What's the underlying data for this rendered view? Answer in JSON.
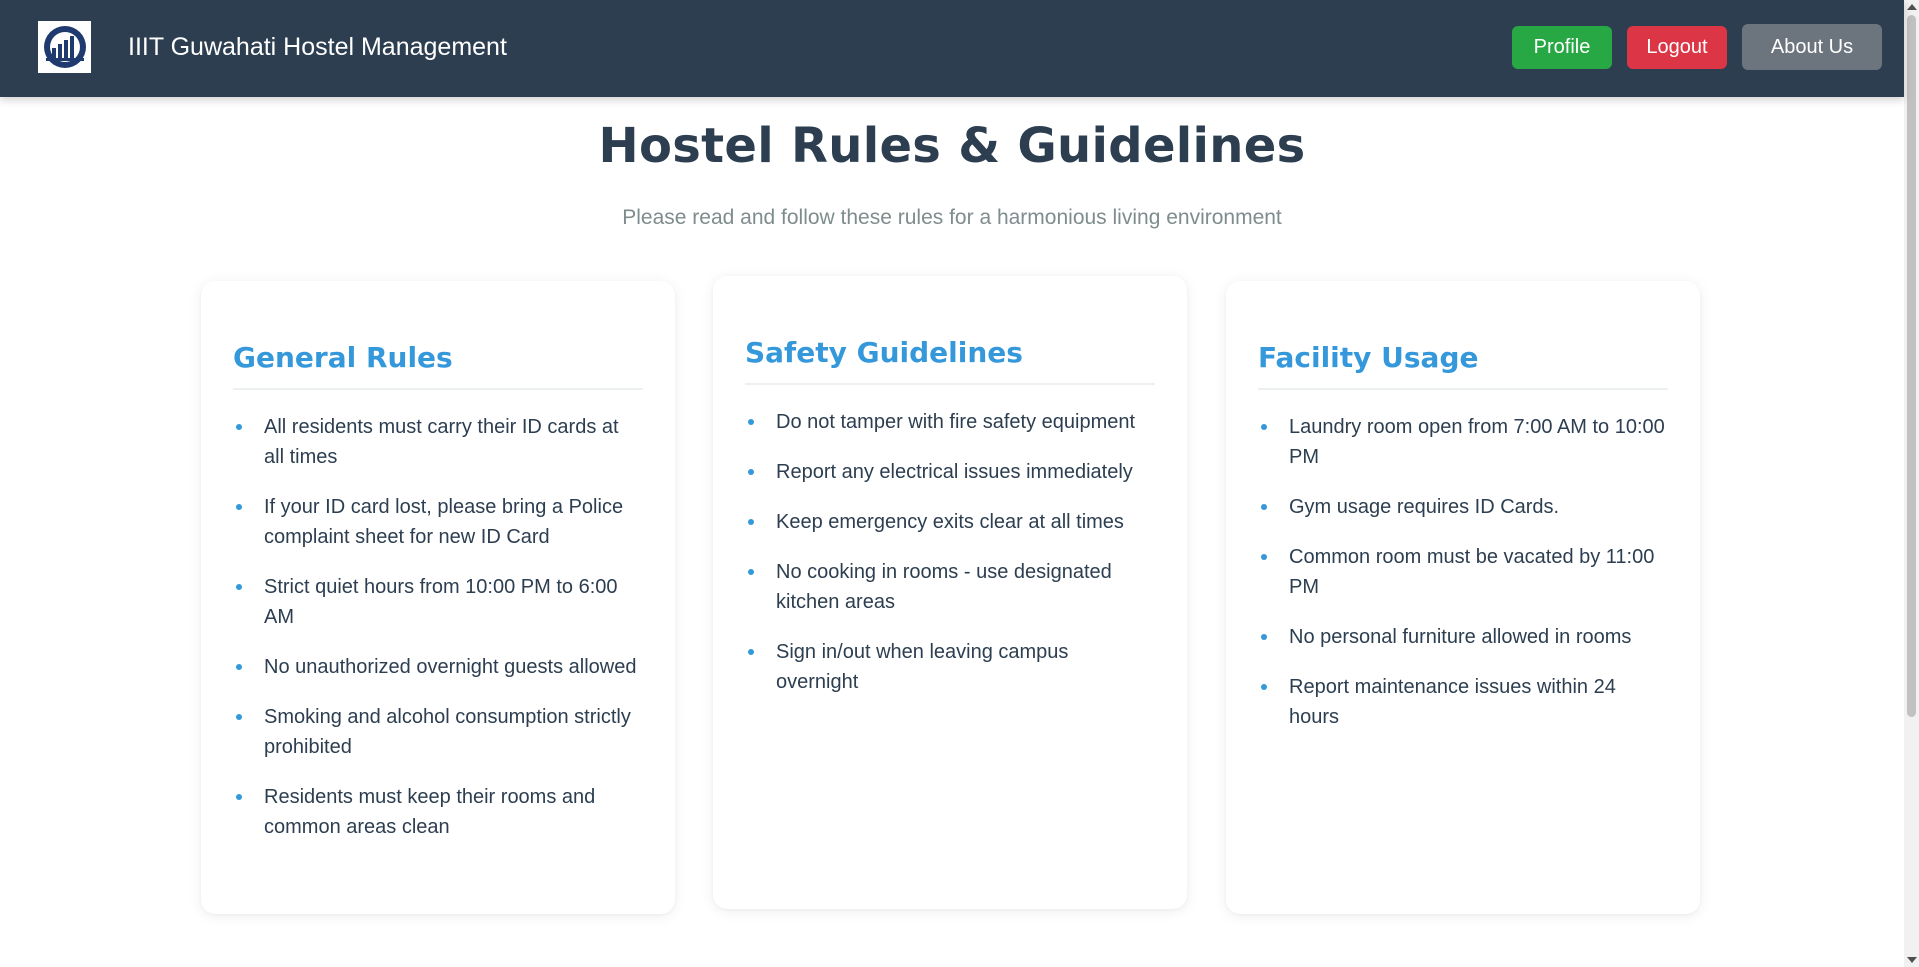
{
  "header": {
    "app_title": "IIIT Guwahati Hostel Management",
    "logo_icon": "iiitg-logo-icon",
    "profile_label": "Profile",
    "logout_label": "Logout",
    "about_label": "About Us"
  },
  "main": {
    "title": "Hostel Rules & Guidelines",
    "subtitle": "Please read and follow these rules for a harmonious living environment",
    "cards": [
      {
        "title": "General Rules",
        "items": [
          "All residents must carry their ID cards at all times",
          "If your ID card lost, please bring a Police complaint sheet for new ID Card",
          "Strict quiet hours from 10:00 PM to 6:00 AM",
          "No unauthorized overnight guests allowed",
          "Smoking and alcohol consumption strictly prohibited",
          "Residents must keep their rooms and common areas clean"
        ]
      },
      {
        "title": "Safety Guidelines",
        "items": [
          "Do not tamper with fire safety equipment",
          "Report any electrical issues immediately",
          "Keep emergency exits clear at all times",
          "No cooking in rooms - use designated kitchen areas",
          "Sign in/out when leaving campus overnight"
        ]
      },
      {
        "title": "Facility Usage",
        "items": [
          "Laundry room open from 7:00 AM to 10:00 PM",
          "Gym usage requires ID Cards.",
          "Common room must be vacated by 11:00 PM",
          "No personal furniture allowed in rooms",
          "Report maintenance issues within 24 hours"
        ]
      }
    ]
  },
  "colors": {
    "navbar": "#2c3e50",
    "profile_button": "#28a745",
    "logout_button": "#dc3545",
    "about_button": "#6c757d",
    "accent": "#3498db"
  }
}
